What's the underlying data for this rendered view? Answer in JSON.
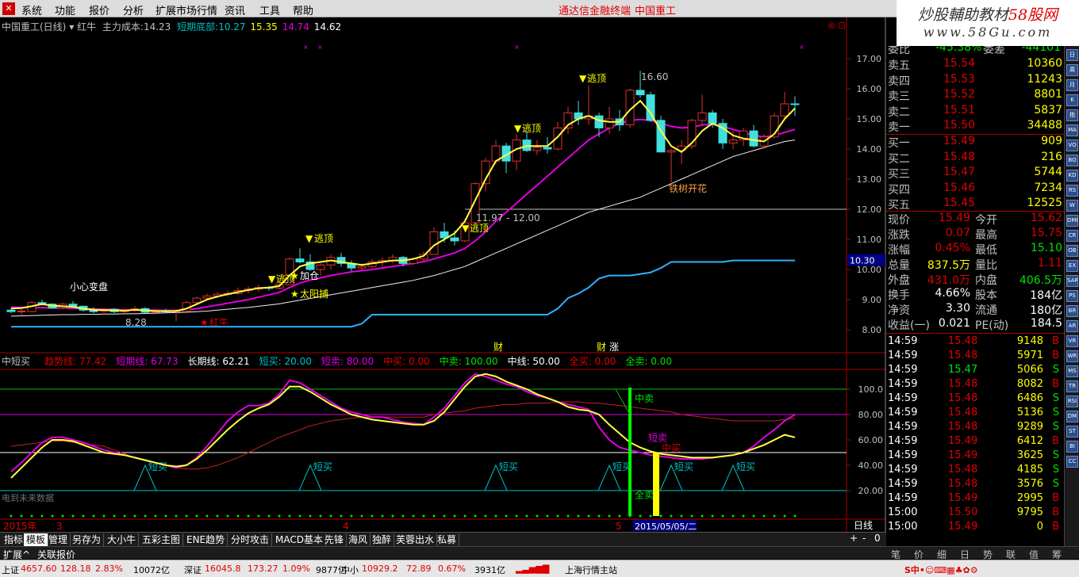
{
  "menubar": {
    "items": [
      "系统",
      "功能",
      "报价",
      "分析",
      "扩展市场行情",
      "资讯",
      "工具",
      "帮助"
    ],
    "center_app": "通达信金融终端",
    "center_stock": "中国重工"
  },
  "watermark": {
    "line1_a": "炒股輔助教材",
    "line1_b": "58股网",
    "line2": "www.58Gu.com"
  },
  "main_info": {
    "title": "中国重工(日线)",
    "indicator": "红牛",
    "label1": "主力成本:",
    "val1": "14.23",
    "label2": "短期底部:",
    "val2": "10.27",
    "val3": "15.35",
    "val4": "14.74",
    "val5": "14.62"
  },
  "price_axis": [
    "17.00",
    "16.00",
    "15.00",
    "14.00",
    "13.00",
    "12.00",
    "11.00",
    "10.00",
    "9.00",
    "8.00"
  ],
  "price_marker": "10.30",
  "annotations": {
    "xiaoxin": "小心变盘",
    "escape1": "逃顶",
    "escape2": "逃顶",
    "escape3": "逃顶",
    "escape4": "逃顶",
    "escape5": "逃顶",
    "jiacang": "加仓",
    "taiyang": "太阳捕",
    "tieshu": "铁树开花",
    "hongniu": "红牛",
    "low": "8.28",
    "high": "16.60",
    "hline": "11.97 - 12.00",
    "cai1": "财",
    "cai2": "财",
    "zhang": "涨"
  },
  "sub_info": {
    "title": "中短买",
    "items": [
      {
        "label": "趋势线:",
        "value": "77.42",
        "color": "#e00000"
      },
      {
        "label": "短期线:",
        "value": "67.73",
        "color": "#e000e0"
      },
      {
        "label": "长期线:",
        "value": "62.21",
        "color": "#ffffff"
      },
      {
        "label": "短买:",
        "value": "20.00",
        "color": "#00c0c0"
      },
      {
        "label": "短卖:",
        "value": "80.00",
        "color": "#e000e0"
      },
      {
        "label": "中买:",
        "value": "0.00",
        "color": "#e00000"
      },
      {
        "label": "中卖:",
        "value": "100.00",
        "color": "#00e000"
      },
      {
        "label": "中线:",
        "value": "50.00",
        "color": "#ffffff"
      },
      {
        "label": "全买:",
        "value": "0.00",
        "color": "#e00000"
      },
      {
        "label": "全卖:",
        "value": "0.00",
        "color": "#00e000"
      }
    ]
  },
  "sub_axis": [
    "100.0",
    "80.00",
    "60.00",
    "40.00",
    "20.00"
  ],
  "sub_annotations": {
    "zhongmai": "中卖",
    "duanmai_sell": "短卖",
    "zhongmai_buy": "中买",
    "quanmai": "全卖",
    "duanmai_buy": "短买",
    "note": "电到未来数据"
  },
  "date_axis": {
    "year": "2015年",
    "m3": "3",
    "m4": "4",
    "m5": "5",
    "cursor_date": "2015/05/05/二",
    "period": "日线"
  },
  "tabs": [
    "指标",
    "模板",
    "管理",
    "另存为",
    "大小牛",
    "五彩主图",
    "ENE趋势",
    "分时攻击",
    "MACD基本",
    "先锋",
    "海风",
    "独醉",
    "芙蓉出水",
    "私募"
  ],
  "tab_nav": [
    "+",
    "-",
    "0"
  ],
  "ext_bar": [
    "扩展^",
    "关联报价"
  ],
  "right_tabs": [
    "笔",
    "价",
    "细",
    "日",
    "势",
    "联",
    "值",
    "筹"
  ],
  "quote": {
    "commission": {
      "label": "委比",
      "value": "-45.38%",
      "label2": "委差",
      "value2": "-44101"
    },
    "sells": [
      {
        "label": "卖五",
        "price": "15.54",
        "vol": "10360"
      },
      {
        "label": "卖四",
        "price": "15.53",
        "vol": "11243"
      },
      {
        "label": "卖三",
        "price": "15.52",
        "vol": "8801"
      },
      {
        "label": "卖二",
        "price": "15.51",
        "vol": "5837"
      },
      {
        "label": "卖一",
        "price": "15.50",
        "vol": "34488"
      }
    ],
    "buys": [
      {
        "label": "买一",
        "price": "15.49",
        "vol": "909"
      },
      {
        "label": "买二",
        "price": "15.48",
        "vol": "216"
      },
      {
        "label": "买三",
        "price": "15.47",
        "vol": "5744"
      },
      {
        "label": "买四",
        "price": "15.46",
        "vol": "7234"
      },
      {
        "label": "买五",
        "price": "15.45",
        "vol": "12525"
      }
    ],
    "stats": [
      {
        "l1": "现价",
        "v1": "15.49",
        "c1": "#e00000",
        "l2": "今开",
        "v2": "15.62",
        "c2": "#e00000"
      },
      {
        "l1": "涨跌",
        "v1": "0.07",
        "c1": "#e00000",
        "l2": "最高",
        "v2": "15.75",
        "c2": "#e00000"
      },
      {
        "l1": "涨幅",
        "v1": "0.45%",
        "c1": "#e00000",
        "l2": "最低",
        "v2": "15.10",
        "c2": "#00e000"
      },
      {
        "l1": "总量",
        "v1": "837.5万",
        "c1": "#ffff00",
        "l2": "量比",
        "v2": "1.11",
        "c2": "#e00000"
      },
      {
        "l1": "外盘",
        "v1": "431.0万",
        "c1": "#e00000",
        "l2": "内盘",
        "v2": "406.5万",
        "c2": "#00e000"
      },
      {
        "l1": "换手",
        "v1": "4.66%",
        "c1": "#ffffff",
        "l2": "股本",
        "v2": "184亿",
        "c2": "#ffffff"
      },
      {
        "l1": "净资",
        "v1": "3.30",
        "c1": "#ffffff",
        "l2": "流通",
        "v2": "180亿",
        "c2": "#ffffff"
      },
      {
        "l1": "收益(一)",
        "v1": "0.021",
        "c1": "#ffffff",
        "l2": "PE(动)",
        "v2": "184.5",
        "c2": "#ffffff"
      }
    ],
    "ticks": [
      {
        "t": "14:59",
        "p": "15.48",
        "v": "9148",
        "s": "B"
      },
      {
        "t": "14:59",
        "p": "15.48",
        "v": "5971",
        "s": "B"
      },
      {
        "t": "14:59",
        "p": "15.47",
        "v": "5066",
        "s": "S"
      },
      {
        "t": "14:59",
        "p": "15.48",
        "v": "8082",
        "s": "B"
      },
      {
        "t": "14:59",
        "p": "15.48",
        "v": "6486",
        "s": "S"
      },
      {
        "t": "14:59",
        "p": "15.48",
        "v": "5136",
        "s": "S"
      },
      {
        "t": "14:59",
        "p": "15.48",
        "v": "9289",
        "s": "S"
      },
      {
        "t": "14:59",
        "p": "15.49",
        "v": "6412",
        "s": "B"
      },
      {
        "t": "14:59",
        "p": "15.49",
        "v": "3625",
        "s": "S"
      },
      {
        "t": "14:59",
        "p": "15.48",
        "v": "4185",
        "s": "S"
      },
      {
        "t": "14:59",
        "p": "15.48",
        "v": "3576",
        "s": "S"
      },
      {
        "t": "14:59",
        "p": "15.49",
        "v": "2995",
        "s": "B"
      },
      {
        "t": "15:00",
        "p": "15.50",
        "v": "9795",
        "s": "B"
      },
      {
        "t": "15:00",
        "p": "15.49",
        "v": "0",
        "s": "B"
      }
    ]
  },
  "sidebar_icons": [
    "日",
    "周",
    "月",
    "K",
    "指",
    "MA",
    "VO",
    "BO",
    "KD",
    "RS",
    "W",
    "DMI",
    "CR",
    "OB",
    "EX",
    "SAR",
    "PS",
    "BR",
    "AR",
    "VR",
    "WR",
    "MS",
    "TR",
    "RSI",
    "DM",
    "ST",
    "BI",
    "CC"
  ],
  "statusbar": {
    "sh_label": "上证",
    "sh_val": "4657.60",
    "sh_chg": "128.18",
    "sh_pct": "2.83%",
    "sh_amt": "10072亿",
    "sz_label": "深证",
    "sz_val": "16045.8",
    "sz_chg": "173.27",
    "sz_pct": "1.09%",
    "sz_amt": "9877亿",
    "zx_label": "中小",
    "zx_val": "10929.2",
    "zx_chg": "72.89",
    "zx_pct": "0.67%",
    "zx_amt": "3931亿",
    "server": "上海行情主站"
  },
  "chart_data": {
    "type": "candlestick",
    "title": "中国重工(日线)",
    "ylim": [
      7.8,
      17.2
    ],
    "candles": [
      [
        8.65,
        8.72,
        8.55,
        8.6
      ],
      [
        8.6,
        8.7,
        8.5,
        8.62
      ],
      [
        8.6,
        8.95,
        8.58,
        8.9
      ],
      [
        8.9,
        9.0,
        8.8,
        8.85
      ],
      [
        8.85,
        8.88,
        8.7,
        8.72
      ],
      [
        8.72,
        8.9,
        8.68,
        8.85
      ],
      [
        8.85,
        8.95,
        8.75,
        8.78
      ],
      [
        8.78,
        8.8,
        8.6,
        8.65
      ],
      [
        8.65,
        8.75,
        8.55,
        8.6
      ],
      [
        8.62,
        8.7,
        8.5,
        8.68
      ],
      [
        8.68,
        8.72,
        8.55,
        8.6
      ],
      [
        8.6,
        8.7,
        8.5,
        8.65
      ],
      [
        8.65,
        8.78,
        8.6,
        8.7
      ],
      [
        8.7,
        8.75,
        8.55,
        8.58
      ],
      [
        8.58,
        8.65,
        8.5,
        8.62
      ],
      [
        8.62,
        8.7,
        8.55,
        8.6
      ],
      [
        8.6,
        8.68,
        8.28,
        8.62
      ],
      [
        8.62,
        8.95,
        8.6,
        8.9
      ],
      [
        8.9,
        9.1,
        8.85,
        9.05
      ],
      [
        9.05,
        9.2,
        8.98,
        9.12
      ],
      [
        9.12,
        9.25,
        9.05,
        9.18
      ],
      [
        9.18,
        9.3,
        9.1,
        9.2
      ],
      [
        9.2,
        9.4,
        9.15,
        9.3
      ],
      [
        9.3,
        9.45,
        9.2,
        9.35
      ],
      [
        9.35,
        9.5,
        9.25,
        9.4
      ],
      [
        9.4,
        9.45,
        9.3,
        9.38
      ],
      [
        9.38,
        9.55,
        9.35,
        9.5
      ],
      [
        9.5,
        10.4,
        9.48,
        10.35
      ],
      [
        10.35,
        10.7,
        10.2,
        10.25
      ],
      [
        10.25,
        10.5,
        9.95,
        10.0
      ],
      [
        10.0,
        10.2,
        9.8,
        10.15
      ],
      [
        10.15,
        10.5,
        10.0,
        10.4
      ],
      [
        10.4,
        10.55,
        10.1,
        10.2
      ],
      [
        10.2,
        10.3,
        9.95,
        10.05
      ],
      [
        10.05,
        10.2,
        9.95,
        10.1
      ],
      [
        10.1,
        10.35,
        10.05,
        10.25
      ],
      [
        10.25,
        10.4,
        10.1,
        10.3
      ],
      [
        10.3,
        10.5,
        10.2,
        10.4
      ],
      [
        10.4,
        10.45,
        10.1,
        10.2
      ],
      [
        10.2,
        10.4,
        10.15,
        10.35
      ],
      [
        10.35,
        10.6,
        10.25,
        10.5
      ],
      [
        10.5,
        11.4,
        10.48,
        11.25
      ],
      [
        11.25,
        11.55,
        10.9,
        11.05
      ],
      [
        11.05,
        11.3,
        10.8,
        10.95
      ],
      [
        10.95,
        11.7,
        10.9,
        11.55
      ],
      [
        11.55,
        12.9,
        11.5,
        12.85
      ],
      [
        12.85,
        13.7,
        12.6,
        13.6
      ],
      [
        13.6,
        14.3,
        13.5,
        14.1
      ],
      [
        14.1,
        14.2,
        13.2,
        13.6
      ],
      [
        13.6,
        14.5,
        13.3,
        14.3
      ],
      [
        14.3,
        14.6,
        13.9,
        13.95
      ],
      [
        13.95,
        14.3,
        13.8,
        14.05
      ],
      [
        14.05,
        14.4,
        13.85,
        14.0
      ],
      [
        14.0,
        14.9,
        13.95,
        14.7
      ],
      [
        14.7,
        15.4,
        14.5,
        15.2
      ],
      [
        15.2,
        15.6,
        14.8,
        15.0
      ],
      [
        15.0,
        16.1,
        14.8,
        15.1
      ],
      [
        15.1,
        15.2,
        14.4,
        14.7
      ],
      [
        14.7,
        15.4,
        14.5,
        15.0
      ],
      [
        15.0,
        15.3,
        14.6,
        14.8
      ],
      [
        14.8,
        16.0,
        14.7,
        15.95
      ],
      [
        15.95,
        16.6,
        15.7,
        15.8
      ],
      [
        15.8,
        15.9,
        14.9,
        14.95
      ],
      [
        14.95,
        15.1,
        13.9,
        13.9
      ],
      [
        13.9,
        14.0,
        12.9,
        13.95
      ],
      [
        13.95,
        14.3,
        13.5,
        14.1
      ],
      [
        14.1,
        15.0,
        14.0,
        14.95
      ],
      [
        14.95,
        15.8,
        14.8,
        15.2
      ],
      [
        15.2,
        15.3,
        14.7,
        14.85
      ],
      [
        14.85,
        15.0,
        14.0,
        14.2
      ],
      [
        14.2,
        14.6,
        14.0,
        14.3
      ],
      [
        14.3,
        14.7,
        14.1,
        14.6
      ],
      [
        14.6,
        14.8,
        14.05,
        14.1
      ],
      [
        14.1,
        14.5,
        14.0,
        14.4
      ],
      [
        14.4,
        15.2,
        14.35,
        15.1
      ],
      [
        15.1,
        15.9,
        15.0,
        15.5
      ],
      [
        15.5,
        15.75,
        15.1,
        15.49
      ]
    ],
    "ma_white": [
      8.45,
      8.46,
      8.47,
      8.48,
      8.49,
      8.5,
      8.5,
      8.51,
      8.51,
      8.52,
      8.52,
      8.53,
      8.53,
      8.54,
      8.55,
      8.56,
      8.57,
      8.58,
      8.6,
      8.62,
      8.65,
      8.68,
      8.71,
      8.74,
      8.78,
      8.82,
      8.86,
      8.92,
      8.98,
      9.04,
      9.1,
      9.16,
      9.22,
      9.28,
      9.34,
      9.4,
      9.46,
      9.52,
      9.58,
      9.64,
      9.72,
      9.8,
      9.9,
      10.0,
      10.1,
      10.25,
      10.4,
      10.55,
      10.7,
      10.85,
      11.0,
      11.15,
      11.3,
      11.45,
      11.6,
      11.75,
      11.9,
      12.0,
      12.1,
      12.2,
      12.3,
      12.4,
      12.55,
      12.7,
      12.85,
      13.0,
      13.15,
      13.3,
      13.45,
      13.6,
      13.75,
      13.85,
      13.95,
      14.05,
      14.15,
      14.25,
      14.3
    ],
    "ma_magenta": [
      8.75,
      8.74,
      8.73,
      8.73,
      8.72,
      8.72,
      8.71,
      8.7,
      8.69,
      8.68,
      8.67,
      8.66,
      8.65,
      8.65,
      8.65,
      8.64,
      8.64,
      8.66,
      8.7,
      8.76,
      8.82,
      8.88,
      8.94,
      9.0,
      9.08,
      9.16,
      9.24,
      9.4,
      9.55,
      9.65,
      9.72,
      9.8,
      9.86,
      9.92,
      9.96,
      10.0,
      10.05,
      10.1,
      10.15,
      10.2,
      10.26,
      10.35,
      10.45,
      10.55,
      10.7,
      10.95,
      11.25,
      11.6,
      11.9,
      12.2,
      12.5,
      12.8,
      13.1,
      13.4,
      13.7,
      14.0,
      14.3,
      14.5,
      14.7,
      14.85,
      14.95,
      14.98,
      14.95,
      14.85,
      14.75,
      14.7,
      14.72,
      14.8,
      14.82,
      14.75,
      14.65,
      14.55,
      14.45,
      14.4,
      14.45,
      14.55,
      14.65
    ],
    "ma_yellow": [
      8.7,
      8.72,
      8.78,
      8.85,
      8.8,
      8.78,
      8.76,
      8.7,
      8.66,
      8.65,
      8.64,
      8.63,
      8.66,
      8.64,
      8.62,
      8.62,
      8.62,
      8.7,
      8.85,
      9.0,
      9.1,
      9.18,
      9.25,
      9.32,
      9.38,
      9.4,
      9.45,
      9.8,
      10.1,
      10.2,
      10.25,
      10.3,
      10.25,
      10.2,
      10.15,
      10.2,
      10.25,
      10.3,
      10.3,
      10.35,
      10.45,
      10.8,
      11.0,
      11.2,
      11.6,
      12.3,
      13.0,
      13.6,
      13.8,
      14.0,
      14.1,
      14.1,
      14.1,
      14.4,
      14.8,
      15.0,
      15.1,
      14.95,
      14.9,
      14.9,
      15.3,
      15.6,
      15.2,
      14.6,
      14.1,
      13.9,
      14.2,
      14.6,
      14.85,
      14.7,
      14.45,
      14.35,
      14.3,
      14.25,
      14.5,
      15.0,
      15.35
    ],
    "support_line": [
      8.1,
      8.1,
      8.1,
      8.1,
      8.1,
      8.1,
      8.1,
      8.1,
      8.1,
      8.1,
      8.1,
      8.1,
      8.1,
      8.1,
      8.1,
      8.1,
      8.1,
      8.1,
      8.1,
      8.1,
      8.1,
      8.1,
      8.1,
      8.1,
      8.1,
      8.1,
      8.1,
      8.1,
      8.1,
      8.1,
      8.1,
      8.1,
      8.1,
      8.1,
      8.2,
      8.5,
      8.5,
      8.5,
      8.5,
      8.5,
      8.5,
      8.5,
      8.5,
      8.5,
      8.5,
      8.5,
      8.5,
      8.5,
      8.5,
      8.5,
      8.5,
      8.5,
      8.5,
      8.7,
      9.05,
      9.2,
      9.4,
      9.7,
      9.8,
      9.8,
      9.8,
      9.85,
      9.9,
      10.05,
      10.25,
      10.25,
      10.25,
      10.25,
      10.25,
      10.25,
      10.3,
      10.3,
      10.3,
      10.3,
      10.3,
      10.3,
      10.3
    ],
    "hline": 12.0
  },
  "chart_sub_data": {
    "type": "line",
    "ylim": [
      0,
      110
    ],
    "trend_red": [
      55,
      56,
      57,
      58,
      59,
      59,
      58,
      57,
      56,
      55,
      52,
      49,
      46,
      44,
      42,
      40,
      38,
      37,
      37,
      38,
      40,
      43,
      46,
      50,
      54,
      58,
      62,
      65,
      68,
      71,
      73,
      75,
      76,
      77,
      78,
      78,
      78,
      78,
      78,
      78,
      78,
      80,
      81,
      82,
      83,
      85,
      86,
      87,
      88,
      88,
      89,
      89,
      89,
      90,
      90,
      90,
      89,
      89,
      88,
      87,
      86,
      85,
      84,
      83,
      82,
      80,
      79,
      78,
      77,
      76,
      75,
      75,
      75,
      75,
      75,
      76,
      77
    ],
    "short_magenta": [
      35,
      42,
      50,
      58,
      62,
      62,
      60,
      58,
      55,
      52,
      50,
      48,
      46,
      44,
      42,
      40,
      38,
      40,
      46,
      55,
      65,
      75,
      82,
      87,
      87,
      89,
      96,
      107,
      105,
      100,
      95,
      90,
      85,
      82,
      80,
      78,
      78,
      76,
      74,
      73,
      72,
      78,
      85,
      95,
      105,
      112,
      110,
      107,
      104,
      102,
      98,
      95,
      93,
      90,
      88,
      86,
      84,
      70,
      60,
      54,
      52,
      50,
      48,
      47,
      46,
      45,
      45,
      45,
      46,
      47,
      48,
      50,
      55,
      62,
      68,
      75,
      80
    ],
    "long_yellow": [
      30,
      38,
      46,
      54,
      60,
      60,
      59,
      56,
      53,
      50,
      49,
      48,
      46,
      44,
      42,
      40,
      39,
      40,
      45,
      52,
      60,
      68,
      75,
      81,
      85,
      88,
      94,
      102,
      102,
      98,
      93,
      88,
      84,
      80,
      78,
      76,
      75,
      74,
      73,
      72,
      72,
      75,
      82,
      92,
      102,
      110,
      112,
      110,
      106,
      103,
      100,
      96,
      93,
      90,
      86,
      84,
      83,
      80,
      72,
      65,
      58,
      54,
      51,
      49,
      48,
      47,
      46,
      46,
      46,
      47,
      48,
      50,
      53,
      56,
      60,
      64,
      62
    ],
    "buy_markers": [
      13,
      29,
      47,
      58,
      64,
      70
    ]
  }
}
